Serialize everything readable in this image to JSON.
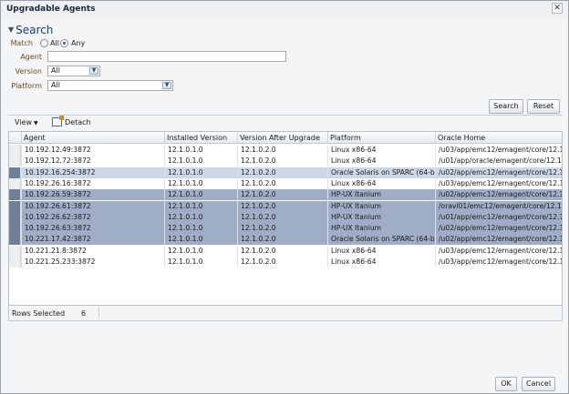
{
  "dialog": {
    "title": "Upgradable Agents",
    "close_glyph": "✕"
  },
  "search": {
    "heading": "Search",
    "match_label": "Match",
    "match_all": "All",
    "match_any": "Any",
    "agent_label": "Agent",
    "agent_value": "",
    "version_label": "Version",
    "version_value": "All",
    "platform_label": "Platform",
    "platform_value": "All",
    "search_button": "Search",
    "reset_button": "Reset"
  },
  "toolbar": {
    "view_label": "View",
    "detach_label": "Detach"
  },
  "table": {
    "columns": [
      "Agent",
      "Installed Version",
      "Version After Upgrade",
      "Platform",
      "Oracle Home"
    ],
    "rows": [
      {
        "agent": "10.192.12.49:3872",
        "installed": "12.1.0.1.0",
        "after": "12.1.0.2.0",
        "platform": "Linux x86-64",
        "home": "/u03/app/emc12/emagent/core/12.1.",
        "state": "none"
      },
      {
        "agent": "10.192.12.72:3872",
        "installed": "12.1.0.1.0",
        "after": "12.1.0.2.0",
        "platform": "Linux x86-64",
        "home": "/u01/app/oracle/emagent/core/12.1.0",
        "state": "none"
      },
      {
        "agent": "10.192.16.254:3872",
        "installed": "12.1.0.1.0",
        "after": "12.1.0.2.0",
        "platform": "Oracle Solaris on SPARC (64-bit",
        "home": "/u02/app/emc12/emagent/core/12.1.",
        "state": "lite"
      },
      {
        "agent": "10.192.26.16:3872",
        "installed": "12.1.0.1.0",
        "after": "12.1.0.2.0",
        "platform": "Linux x86-64",
        "home": "/u03/app/emc12/emagent/core/12.1.",
        "state": "none"
      },
      {
        "agent": "10.192.26.59:3872",
        "installed": "12.1.0.1.0",
        "after": "12.1.0.2.0",
        "platform": "HP-UX Itanium",
        "home": "/u02/app/emc12/emagent/core/12.1.0",
        "state": "sel"
      },
      {
        "agent": "10.192.26.61:3872",
        "installed": "12.1.0.1.0",
        "after": "12.1.0.2.0",
        "platform": "HP-UX Itanium",
        "home": "/oravl01/emc12/emagent/core/12.1.0",
        "state": "sel"
      },
      {
        "agent": "10.192.26.62:3872",
        "installed": "12.1.0.1.0",
        "after": "12.1.0.2.0",
        "platform": "HP-UX Itanium",
        "home": "/u01/app/emc12/emagent/core/12.1.0",
        "state": "sel"
      },
      {
        "agent": "10.192.26.63:3872",
        "installed": "12.1.0.1.0",
        "after": "12.1.0.2.0",
        "platform": "HP-UX Itanium",
        "home": "/u02/app/emc12/emagent/core/12.1.0",
        "state": "sel"
      },
      {
        "agent": "10.221.17.42:3872",
        "installed": "12.1.0.1.0",
        "after": "12.1.0.2.0",
        "platform": "Oracle Solaris on SPARC (64-bit",
        "home": "/u02/app/emc12/emagent/core/12.1.",
        "state": "sel"
      },
      {
        "agent": "10.221.21.8:3872",
        "installed": "12.1.0.1.0",
        "after": "12.1.0.2.0",
        "platform": "Linux x86-64",
        "home": "/u03/app/emc12/emagent/core/12.1.",
        "state": "none"
      },
      {
        "agent": "10.221.25.233:3872",
        "installed": "12.1.0.1.0",
        "after": "12.1.0.2.0",
        "platform": "Linux x86-64",
        "home": "/u03/app/emc12/emagent/core/12.1.",
        "state": "none"
      }
    ]
  },
  "footer": {
    "rows_selected_label": "Rows Selected",
    "rows_selected_count": "6"
  },
  "actions": {
    "ok_label": "OK",
    "cancel_label": "Cancel"
  }
}
